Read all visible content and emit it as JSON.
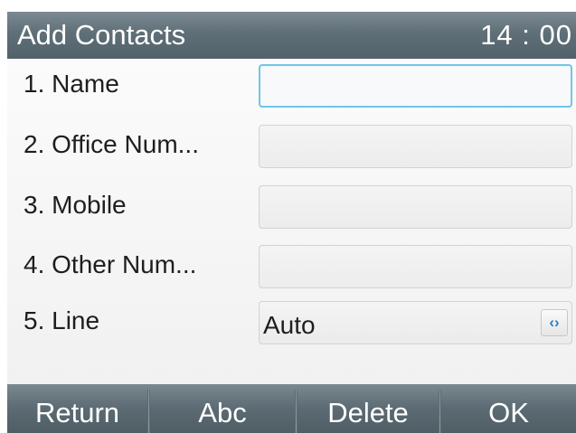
{
  "header": {
    "title": "Add Contacts",
    "clock": "14 : 00"
  },
  "form": {
    "rows": [
      {
        "label": "1.  Name",
        "value": ""
      },
      {
        "label": "2.  Office Num...",
        "value": ""
      },
      {
        "label": "3.  Mobile",
        "value": ""
      },
      {
        "label": "4.  Other Num...",
        "value": ""
      },
      {
        "label": "5.  Line",
        "value": "Auto",
        "arrow": "‹›"
      }
    ]
  },
  "softkeys": {
    "return": "Return",
    "abc": "Abc",
    "delete": "Delete",
    "ok": "OK"
  },
  "colors": {
    "header_bar": "#5f6f78",
    "focus_border": "#6dc7e8",
    "arrow_accent": "#2b7fc2"
  }
}
